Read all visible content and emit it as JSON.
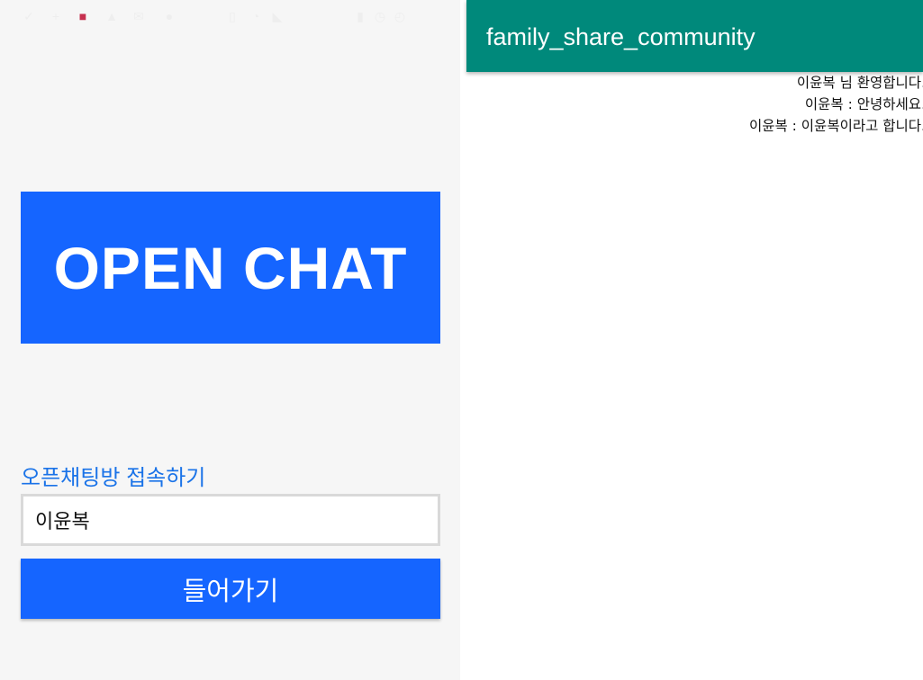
{
  "left_screen": {
    "status_bar": {
      "icons": [
        "check-icon",
        "plus-icon",
        "megaphone-icon",
        "warning-icon",
        "envelope-icon",
        "circle-icon",
        "vibrate-icon",
        "wifi-icon",
        "no-signal-icon",
        "battery-icon",
        "alarm-icon",
        "clock-icon"
      ]
    },
    "banner_title": "OPEN CHAT",
    "join_label": "오픈채팅방 접속하기",
    "name_input_value": "이윤복",
    "enter_button_label": "들어가기"
  },
  "right_screen": {
    "app_title": "family_share_community",
    "messages": [
      "이윤복 님 환영합니다.",
      "이윤복 : 안녕하세요.",
      "이윤복 : 이윤복이라고 합니다."
    ]
  },
  "colors": {
    "primary_blue": "#1565ff",
    "link_blue": "#1a73e8",
    "app_bar_teal": "#00897b",
    "notification_red": "#c6304f"
  }
}
